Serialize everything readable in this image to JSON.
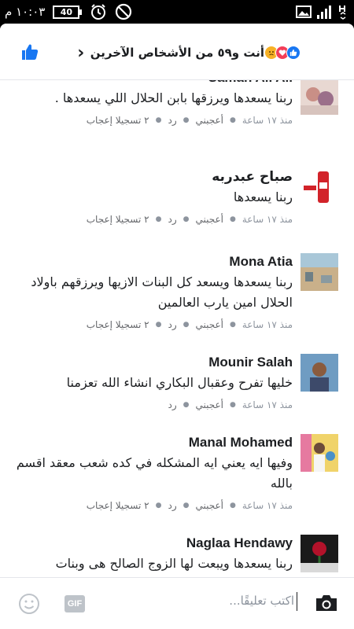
{
  "status_bar": {
    "time": "١٠:٠٣ م",
    "battery": "40"
  },
  "header": {
    "reactors_text": "أنت و٥٩ من الأشخاص الآخرين",
    "reaction_icons": [
      "like-icon",
      "heart-icon",
      "sad-face-icon"
    ]
  },
  "comments": [
    {
      "name": "Samah Ali Ali",
      "text": "ربنا يسعدها ويرزقها بابن الحلال اللي يسعدها .",
      "time": "منذ ١٧ ساعة",
      "like_label": "أعجبني",
      "reply_label": "رد",
      "reactions": "٢ تسجيلا إعجاب"
    },
    {
      "name": "صباح عبدربه",
      "text": "ربنا يسعدها",
      "time": "منذ ١٧ ساعة",
      "like_label": "أعجبني",
      "reply_label": "رد",
      "reactions": "٢ تسجيلا إعجاب"
    },
    {
      "name": "Mona Atia",
      "text": "ربنا يسعدها ويسعد كل البنات الازيها ويرزقهم باولاد الحلال امين يارب العالمين",
      "time": "منذ ١٧ ساعة",
      "like_label": "أعجبني",
      "reply_label": "رد",
      "reactions": "٢ تسجيلا إعجاب"
    },
    {
      "name": "Mounir Salah",
      "text": "خليها تفرح وعقبال البكاري انشاء الله تعزمنا",
      "time": "منذ ١٧ ساعة",
      "like_label": "أعجبني",
      "reply_label": "رد",
      "reactions": ""
    },
    {
      "name": "Manal Mohamed",
      "text": "وفيها ايه يعني ايه المشكله في كده شعب معقد اقسم بالله",
      "time": "منذ ١٧ ساعة",
      "like_label": "أعجبني",
      "reply_label": "رد",
      "reactions": "٢ تسجيلا إعجاب"
    },
    {
      "name": "Naglaa Hendawy",
      "text": "ربنا يسعدها ويبعت لها الزوج الصالح هى وبنات المسلمين",
      "time": "",
      "like_label": "",
      "reply_label": "",
      "reactions": ""
    }
  ],
  "composer": {
    "placeholder": "اكتب تعليقًا...",
    "gif_label": "GIF"
  },
  "colors": {
    "link_blue": "#1877f2",
    "meta_gray": "#8d949e",
    "text": "#1c1e21"
  }
}
